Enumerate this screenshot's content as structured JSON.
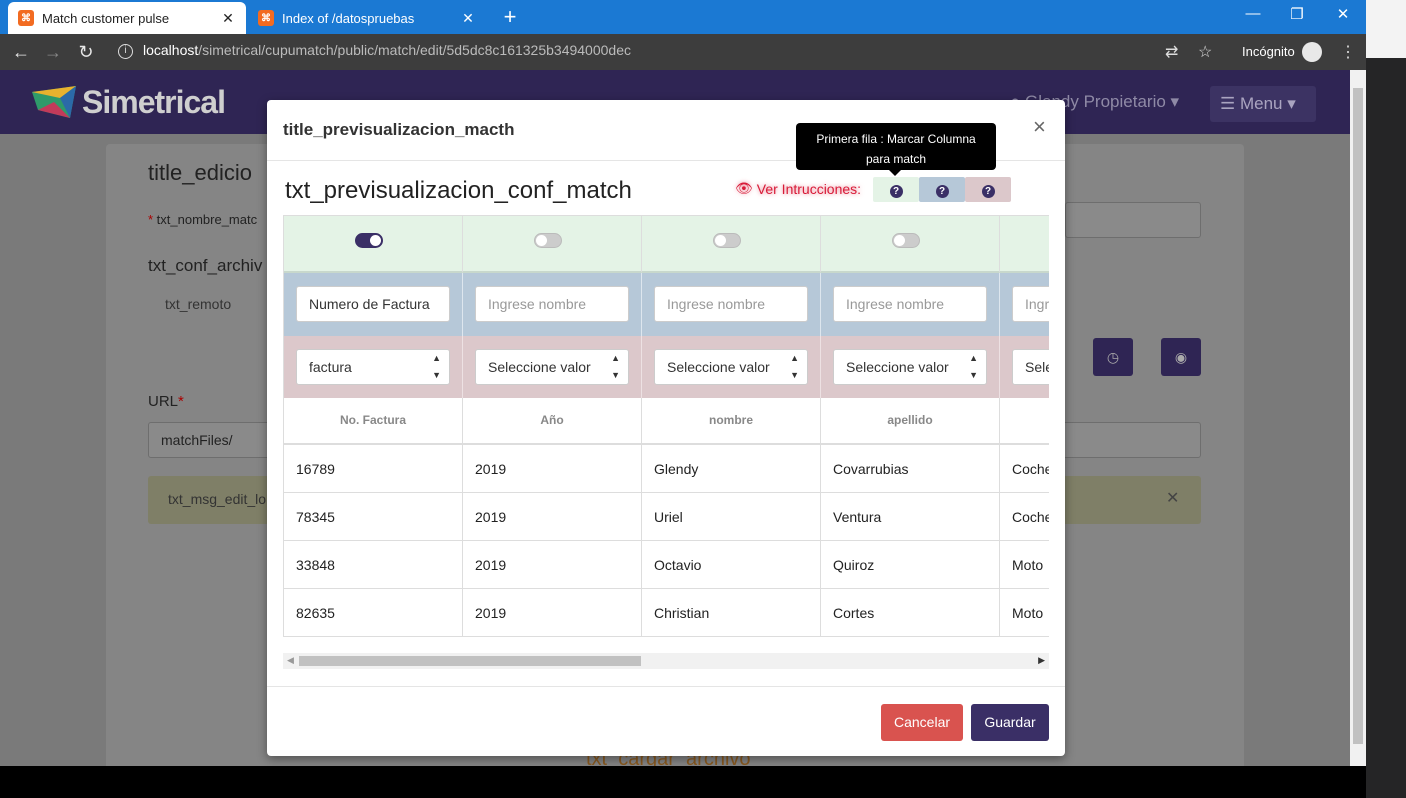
{
  "browser": {
    "tabs": [
      {
        "title": "Match customer pulse",
        "favicon": "xampp-icon"
      },
      {
        "title": "Index of /datospruebas",
        "favicon": "xampp-icon"
      }
    ],
    "url_host": "localhost",
    "url_path": "/simetrical/cupumatch/public/match/edit/5d5dc8c161325b3494000dec",
    "incognito_label": "Incógnito"
  },
  "app": {
    "logo": "Simetrical",
    "user": "Glendy Propietario",
    "menu": "Menu"
  },
  "background": {
    "title": "title_edicio",
    "nombre_label": "txt_nombre_matc",
    "conf_label": "txt_conf_archiv",
    "remote_tab": "txt_remoto",
    "url_label": "URL",
    "url_value": "matchFiles/",
    "alert": "txt_msg_edit_lo",
    "cargar": "txt_cargar_archivo"
  },
  "modal": {
    "title": "title_previsualizacion_macth",
    "close": "×",
    "conf_title": "txt_previsualizacion_conf_match",
    "instructions": "Ver Intrucciones:",
    "tooltip_line1": "Primera fila : Marcar Columna",
    "tooltip_line2": "para match",
    "cancel": "Cancelar",
    "save": "Guardar"
  },
  "table": {
    "toggles": [
      true,
      false,
      false,
      false,
      false
    ],
    "name_inputs": [
      {
        "value": "Numero de Factura",
        "placeholder": ""
      },
      {
        "value": "",
        "placeholder": "Ingrese nombre"
      },
      {
        "value": "",
        "placeholder": "Ingrese nombre"
      },
      {
        "value": "",
        "placeholder": "Ingrese nombre"
      },
      {
        "value": "",
        "placeholder": "Ingrese nombre"
      }
    ],
    "selects": [
      "factura",
      "Seleccione valor",
      "Seleccione valor",
      "Seleccione valor",
      "Seleccione valor"
    ],
    "headers": [
      "No. Factura",
      "Año",
      "nombre",
      "apellido",
      ""
    ],
    "rows": [
      [
        "16789",
        "2019",
        "Glendy",
        "Covarrubias",
        "Coche"
      ],
      [
        "78345",
        "2019",
        "Uriel",
        "Ventura",
        "Coche"
      ],
      [
        "33848",
        "2019",
        "Octavio",
        "Quiroz",
        "Moto"
      ],
      [
        "82635",
        "2019",
        "Christian",
        "Cortes",
        "Moto"
      ]
    ]
  },
  "colors": {
    "brand": "#3a2f66",
    "toggle_row": "#e4f3e6",
    "name_row": "#b6c8d8",
    "select_row": "#dcc8cb",
    "danger": "#d9534f"
  }
}
